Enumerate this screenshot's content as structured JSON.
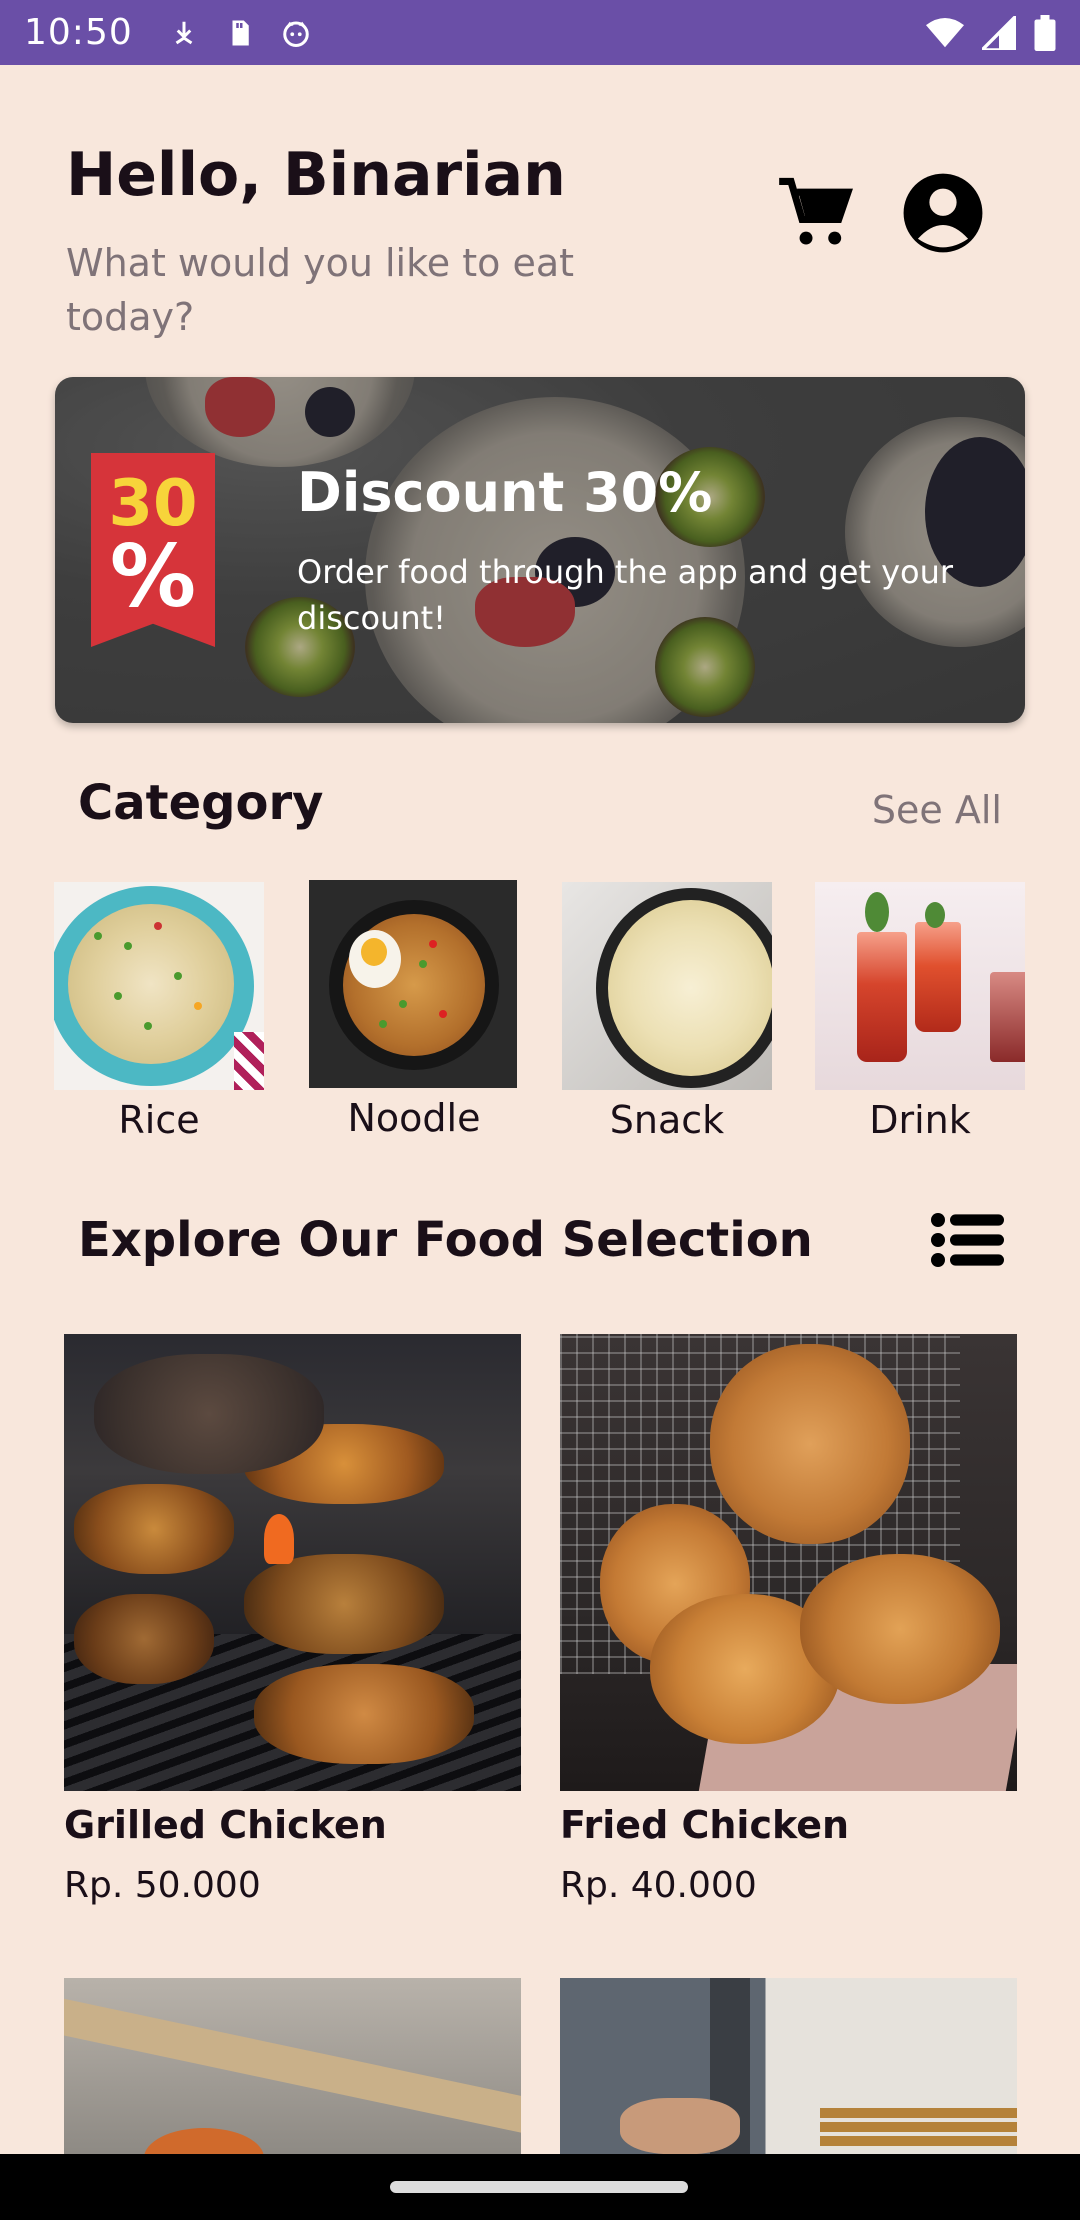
{
  "status_bar": {
    "time": "10:50",
    "left_icons": [
      "download-icon",
      "sd-card-icon",
      "cat-face-icon"
    ],
    "right_icons": [
      "wifi-icon",
      "signal-icon",
      "battery-icon"
    ],
    "background": "#6A4FA7"
  },
  "header": {
    "greeting": "Hello, Binarian",
    "subtitle": "What would you like to eat today?",
    "icons": [
      "cart-icon",
      "profile-icon"
    ]
  },
  "banner": {
    "badge_number": "30",
    "badge_symbol": "%",
    "title": "Discount 30%",
    "text": "Order food through the app and get your discount!"
  },
  "category_section": {
    "title": "Category",
    "see_all": "See All",
    "items": [
      {
        "label": "Rice"
      },
      {
        "label": "Noodle"
      },
      {
        "label": "Snack"
      },
      {
        "label": "Drink"
      }
    ]
  },
  "food_section": {
    "title": "Explore Our Food Selection",
    "view_icon": "list-view-icon",
    "items": [
      {
        "name": "Grilled Chicken",
        "price": "Rp. 50.000"
      },
      {
        "name": "Fried Chicken",
        "price": "Rp. 40.000"
      }
    ]
  },
  "colors": {
    "background": "#F8E7DC",
    "accent_red": "#D6343A",
    "badge_yellow": "#F7D43A"
  }
}
